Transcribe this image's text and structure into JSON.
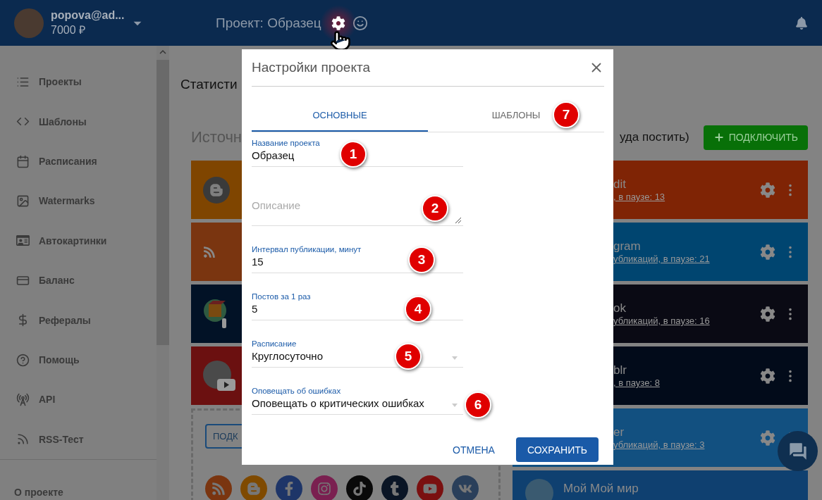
{
  "header": {
    "user": {
      "email": "popova@ad...",
      "balance": "7000 ₽"
    },
    "project_title": "Проект: Образец"
  },
  "sidebar": {
    "items": [
      {
        "label": "Проекты"
      },
      {
        "label": "Шаблоны"
      },
      {
        "label": "Расписания"
      },
      {
        "label": "Watermarks"
      },
      {
        "label": "Автокартинки"
      },
      {
        "label": "Баланс"
      },
      {
        "label": "Рефералы"
      },
      {
        "label": "Помощь"
      },
      {
        "label": "API"
      },
      {
        "label": "RSS-Тест"
      }
    ],
    "footer": "О проекте"
  },
  "main": {
    "heading": "Статисти",
    "section_title": "Источн",
    "section_note": "уда постить)",
    "connect_button": "ПОДКЛЮЧИТЬ",
    "sources": [
      {
        "kind": "blogger",
        "color": "#7f4500"
      },
      {
        "kind": "rss",
        "color": "#7a3510"
      },
      {
        "kind": "bot",
        "color": "#021226"
      },
      {
        "kind": "youtube",
        "color": "#6b1010"
      }
    ],
    "add_button": "ПОДК",
    "destinations": [
      {
        "kind": "partial",
        "title": "dit",
        "link": ", в паузе: 13",
        "color": "#7f2405"
      },
      {
        "kind": "partial",
        "title": "gram",
        "link": "убликаций, в паузе: 21",
        "color": "#004570"
      },
      {
        "kind": "partial",
        "title": "ok",
        "link": "убликаций, в паузе: 16",
        "color": "#0a0a14"
      },
      {
        "kind": "partial",
        "title": "blr",
        "link": ", в паузе: 8",
        "color": "#020b1a"
      },
      {
        "kind": "partial",
        "title": "er",
        "link": "убликаций, в паузе: 3",
        "color": "#125080"
      },
      {
        "kind": "avatar",
        "title": "Мой Мой мир",
        "color": "#0f4070"
      }
    ]
  },
  "dialog": {
    "title": "Настройки проекта",
    "tabs": [
      {
        "label": "ОСНОВНЫЕ",
        "selected": true
      },
      {
        "label": "ШАБЛОНЫ",
        "selected": false,
        "callout": "7"
      }
    ],
    "fields": [
      {
        "kind": "text",
        "label": "Название проекта",
        "value": "Образец",
        "callout": "1"
      },
      {
        "kind": "textarea",
        "placeholder": "Описание",
        "callout": "2"
      },
      {
        "kind": "text",
        "label": "Интервал публикации, минут",
        "value": "15",
        "callout": "3"
      },
      {
        "kind": "text",
        "label": "Постов за 1 раз",
        "value": "5",
        "callout": "4"
      },
      {
        "kind": "select",
        "label": "Расписание",
        "value": "Круглосуточно",
        "callout": "5"
      },
      {
        "kind": "select",
        "label": "Оповещать об ошибках",
        "value": "Оповещать о критических ошибках",
        "callout": "6"
      }
    ],
    "buttons": [
      {
        "kind": "text",
        "label": "ОТМЕНА"
      },
      {
        "kind": "primary",
        "label": "СОХРАНИТЬ"
      }
    ]
  }
}
